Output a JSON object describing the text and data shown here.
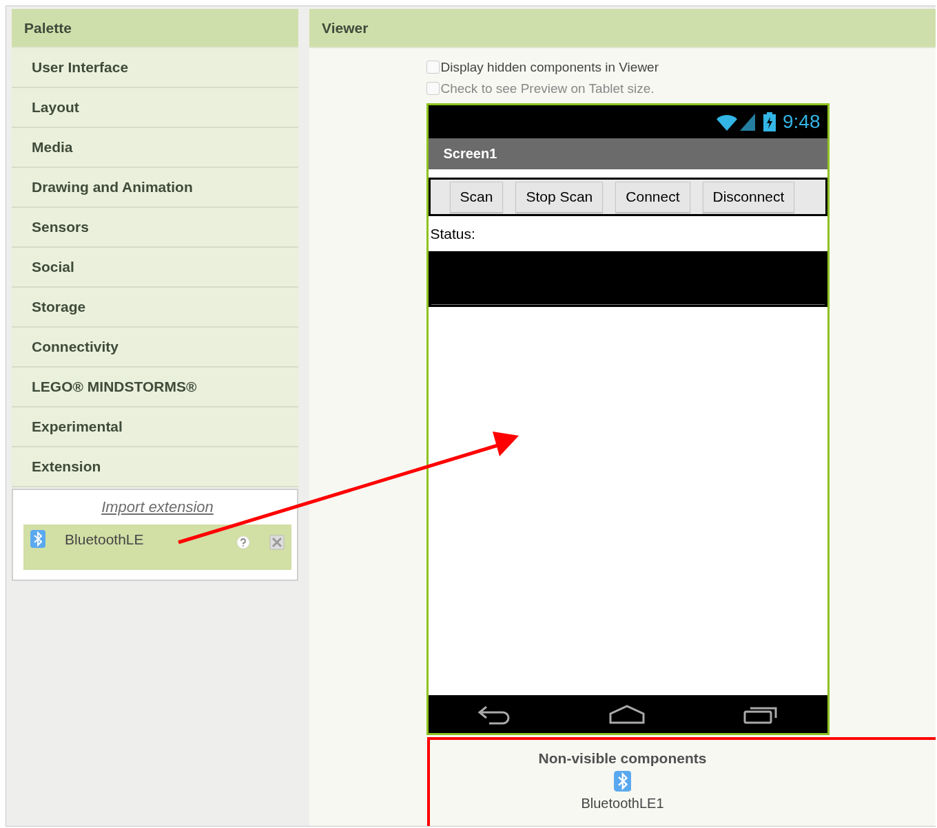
{
  "palette": {
    "title": "Palette",
    "categories": [
      "User Interface",
      "Layout",
      "Media",
      "Drawing and Animation",
      "Sensors",
      "Social",
      "Storage",
      "Connectivity",
      "LEGO® MINDSTORMS®",
      "Experimental",
      "Extension"
    ],
    "import_link": "Import extension",
    "extensions": [
      {
        "name": "BluetoothLE",
        "selected": true
      }
    ]
  },
  "viewer": {
    "title": "Viewer",
    "options": [
      {
        "label": "Display hidden components in Viewer",
        "checked": false
      },
      {
        "label": "Check to see Preview on Tablet size.",
        "checked": false
      }
    ],
    "phone": {
      "time": "9:48",
      "screen_title": "Screen1",
      "buttons": [
        "Scan",
        "Stop Scan",
        "Connect",
        "Disconnect"
      ],
      "status_label": "Status:"
    },
    "non_visible": {
      "title": "Non-visible components",
      "items": [
        "BluetoothLE1"
      ]
    }
  }
}
